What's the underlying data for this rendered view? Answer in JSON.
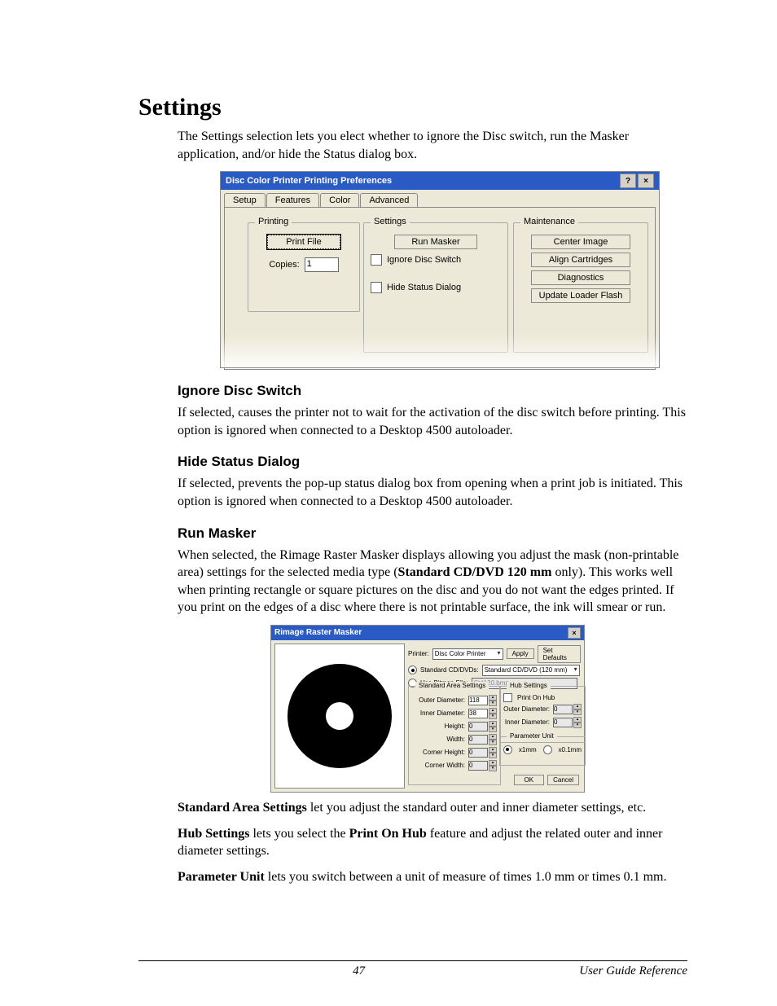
{
  "heading": "Settings",
  "intro": "The Settings selection lets you elect whether to ignore the Disc switch, run the Masker application, and/or hide the Status dialog box.",
  "dlg1": {
    "title": "Disc Color Printer Printing Preferences",
    "tabs": {
      "setup": "Setup",
      "features": "Features",
      "color": "Color",
      "advanced": "Advanced"
    },
    "grp_printing": "Printing",
    "btn_printfile": "Print File",
    "copies_lbl": "Copies:",
    "copies_val": "1",
    "grp_settings": "Settings",
    "btn_runmasker": "Run Masker",
    "chk_ignore": "Ignore Disc Switch",
    "chk_hide": "Hide Status Dialog",
    "grp_maint": "Maintenance",
    "btn_center": "Center Image",
    "btn_align": "Align Cartridges",
    "btn_diag": "Diagnostics",
    "btn_flash": "Update Loader Flash"
  },
  "sec1_h": "Ignore Disc Switch",
  "sec1_p": "If selected, causes the printer not to wait for the activation of the disc switch before printing.  This option is ignored when connected to a Desktop 4500 autoloader.",
  "sec2_h": "Hide Status Dialog",
  "sec2_p": "If selected, prevents the pop-up status dialog box from opening when a print job is initiated. This option is ignored when connected to a Desktop 4500 autoloader.",
  "sec3_h": "Run Masker",
  "sec3_p_a": "When selected, the Rimage Raster Masker displays allowing you adjust the mask (non-printable area) settings for the selected media type (",
  "sec3_p_b_bold": "Standard CD/DVD 120 mm",
  "sec3_p_c": " only). This works well when printing rectangle or square pictures on the disc and you do not want the edges printed. If you print on the edges of a disc where there is not printable surface, the ink will smear or run.",
  "dlg2": {
    "title": "Rimage Raster Masker",
    "printer_lbl": "Printer:",
    "printer_val": "Disc Color Printer",
    "apply": "Apply",
    "setdef": "Set Defaults",
    "radio_std": "Standard CD/DVDs:",
    "std_val": "Standard CD/DVD (120 mm)",
    "radio_bmp": "Use Bitmap File:",
    "bmp_val": "Std120.bmp",
    "grp_std": "Standard Area Settings",
    "outer_d": "Outer Diameter:",
    "inner_d": "Inner Diameter:",
    "height": "Height:",
    "width": "Width:",
    "corner_h": "Corner Height:",
    "corner_w": "Corner Width:",
    "outer_v": "118",
    "inner_v": "38",
    "zero": "0",
    "grp_hub": "Hub Settings",
    "print_hub": "Print On Hub",
    "hub_zero": "0",
    "grp_unit": "Parameter Unit",
    "u1": "x1mm",
    "u01": "x0.1mm",
    "ok": "OK",
    "cancel": "Cancel"
  },
  "para_sas_b": "Standard Area Settings",
  "para_sas": " let you adjust the standard outer and inner diameter settings, etc.",
  "para_hub_b": "Hub Settings",
  "para_hub_mid": " lets you select the ",
  "para_hub_b2": "Print On Hub",
  "para_hub_end": " feature and adjust the related outer and inner diameter settings.",
  "para_unit_b": "Parameter Unit",
  "para_unit": " lets you switch between a unit of measure of times 1.0 mm or times 0.1 mm.",
  "footer_page": "47",
  "footer_doc": "User Guide Reference"
}
